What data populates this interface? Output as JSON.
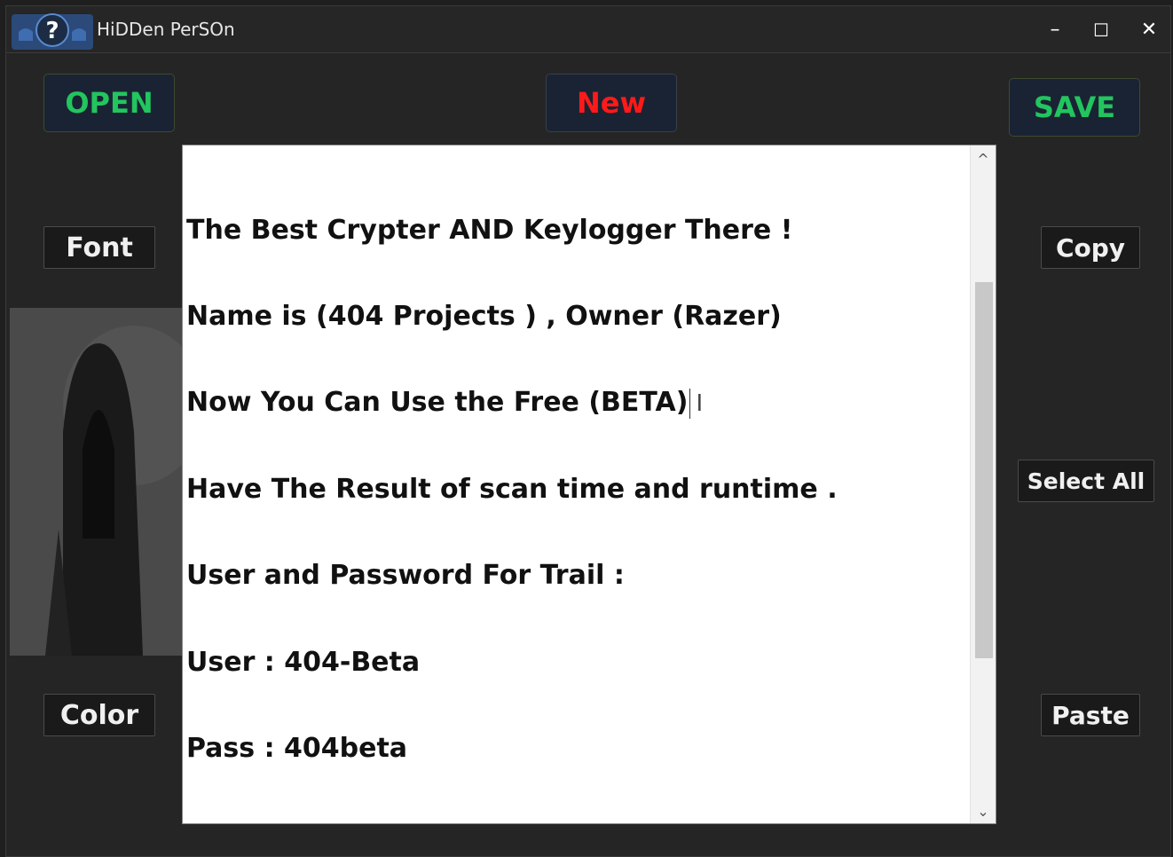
{
  "window": {
    "title": "HiDDen PerSOn",
    "minimize": "–",
    "maximize": "☐",
    "close": "✕"
  },
  "toolbar": {
    "open_label": "OPEN",
    "new_label": "New",
    "save_label": "SAVE"
  },
  "side_buttons": {
    "font_label": "Font",
    "color_label": "Color",
    "copy_label": "Copy",
    "select_all_label": "Select All",
    "paste_label": "Paste"
  },
  "editor": {
    "lines": [
      "The Best Crypter AND Keylogger There !",
      "Name is (404 Projects ) , Owner (Razer)",
      "Now You Can Use the Free (BETA)",
      "Have The Result of scan time and runtime .",
      "User and Password For Trail :",
      "User : 404-Beta",
      "Pass : 404beta"
    ]
  },
  "colors": {
    "open": "#22c55e",
    "new": "#ff1a1a",
    "save": "#22c55e"
  },
  "icons": [
    "hooded-figure-question-icon",
    "minimize-icon",
    "maximize-icon",
    "close-icon",
    "scroll-up-icon",
    "scroll-down-icon",
    "text-cursor-icon"
  ]
}
